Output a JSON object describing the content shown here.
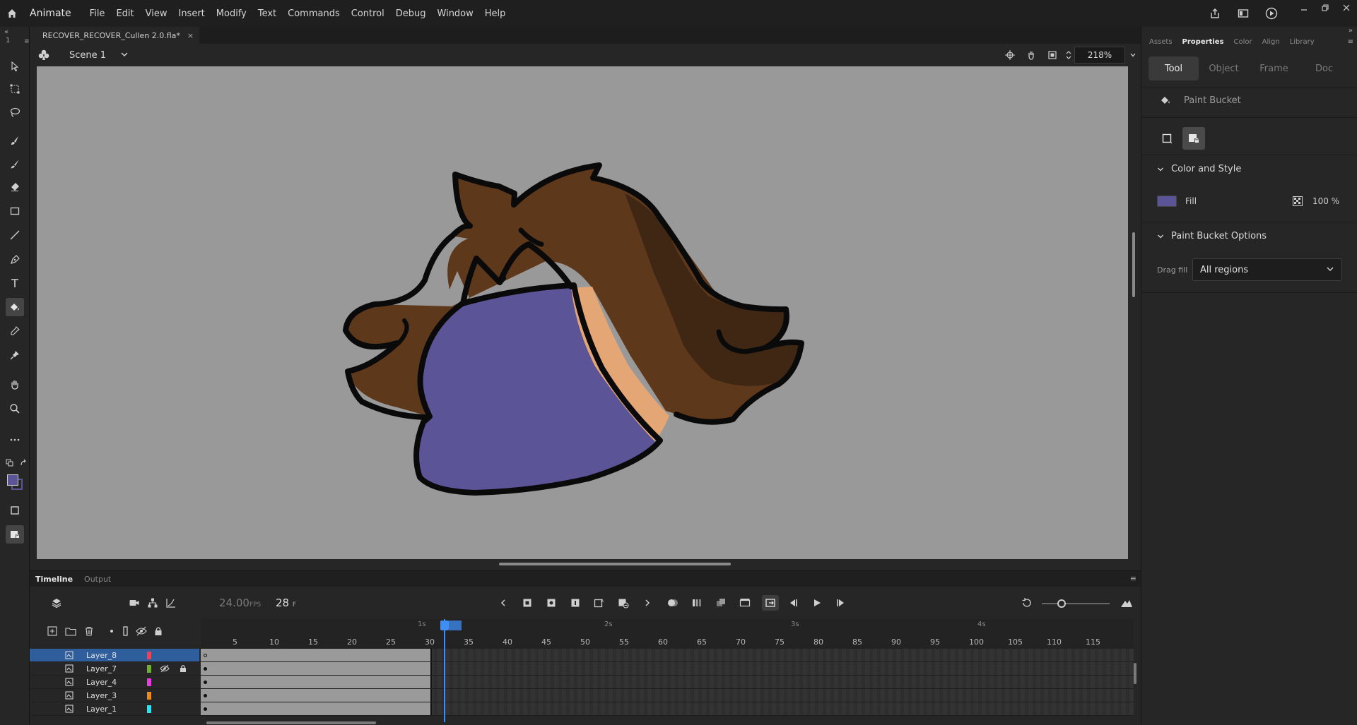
{
  "app": {
    "name": "Animate"
  },
  "menu": [
    "File",
    "Edit",
    "View",
    "Insert",
    "Modify",
    "Text",
    "Commands",
    "Control",
    "Debug",
    "Window",
    "Help"
  ],
  "document": {
    "tab_title": "RECOVER_RECOVER_Cullen 2.0.fla*",
    "close": "×"
  },
  "edit_bar": {
    "scene": "Scene 1",
    "zoom": "218%"
  },
  "left_panel": {
    "collapse": "«",
    "index": "1"
  },
  "colors": {
    "stroke": "#000000",
    "fill": "#5b5497",
    "hair_dark": "#3f2714",
    "hair_mid": "#5e381a",
    "skin": "#e4a675",
    "stage": "#999999",
    "accent": "#3f8ef5"
  },
  "timeline": {
    "tabs": [
      "Timeline",
      "Output"
    ],
    "fps": "24.00",
    "fps_unit": "FPS",
    "current_frame": "28",
    "frame_unit": "F",
    "seconds": [
      "1s",
      "2s",
      "3s",
      "4s"
    ],
    "ticks": [
      "5",
      "10",
      "15",
      "20",
      "25",
      "30",
      "35",
      "40",
      "45",
      "50",
      "55",
      "60",
      "65",
      "70",
      "75",
      "80",
      "85",
      "90",
      "95",
      "100",
      "105",
      "110",
      "115"
    ],
    "layers": [
      {
        "name": "Layer_8",
        "color": "#e8455a",
        "selected": true,
        "hidden": false,
        "locked": false,
        "empty_key": true
      },
      {
        "name": "Layer_7",
        "color": "#6bb232",
        "selected": false,
        "hidden": true,
        "locked": true,
        "empty_key": false
      },
      {
        "name": "Layer_4",
        "color": "#e43ee0",
        "selected": false,
        "hidden": false,
        "locked": false,
        "empty_key": false
      },
      {
        "name": "Layer_3",
        "color": "#f08a1e",
        "selected": false,
        "hidden": false,
        "locked": false,
        "empty_key": false
      },
      {
        "name": "Layer_1",
        "color": "#2ee0f0",
        "selected": false,
        "hidden": false,
        "locked": false,
        "empty_key": false
      }
    ]
  },
  "right_panel": {
    "tabs": [
      "Assets",
      "Properties",
      "Color",
      "Align",
      "Library"
    ],
    "active_tab": "Properties",
    "segments": [
      "Tool",
      "Object",
      "Frame",
      "Doc"
    ],
    "tool_name": "Paint Bucket",
    "color_style": {
      "title": "Color and Style",
      "fill_label": "Fill",
      "alpha": "100 %"
    },
    "bucket_options": {
      "title": "Paint Bucket Options",
      "drag_fill_label": "Drag fill",
      "drag_fill_value": "All regions"
    }
  }
}
